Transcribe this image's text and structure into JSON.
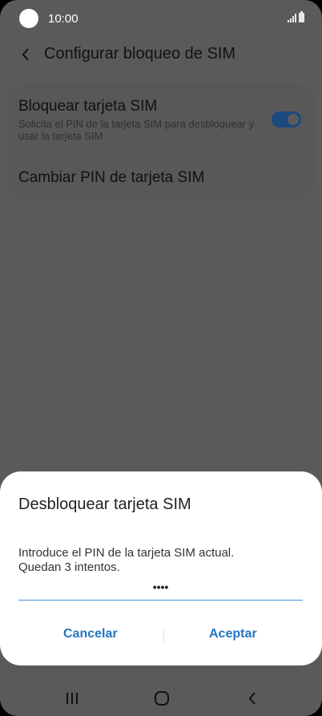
{
  "status_bar": {
    "time": "10:00"
  },
  "header": {
    "title": "Configurar bloqueo de SIM"
  },
  "settings": {
    "lock_sim": {
      "title": "Bloquear tarjeta SIM",
      "subtitle": "Solicita el PIN de la tarjeta SIM para desbloquear y usar la tarjeta SIM.",
      "enabled": true
    },
    "change_pin": {
      "title": "Cambiar PIN de tarjeta SIM"
    }
  },
  "dialog": {
    "title": "Desbloquear tarjeta SIM",
    "message_line1": "Introduce el PIN de la tarjeta SIM actual.",
    "message_line2": "Quedan 3 intentos.",
    "pin_masked": "••••",
    "cancel_label": "Cancelar",
    "accept_label": "Aceptar"
  },
  "colors": {
    "accent": "#2474c2",
    "dim_background": "#5a5a5a",
    "input_underline": "#4a90d9"
  },
  "nav": {
    "icons": [
      "recent-apps-icon",
      "home-icon",
      "back-icon"
    ]
  }
}
